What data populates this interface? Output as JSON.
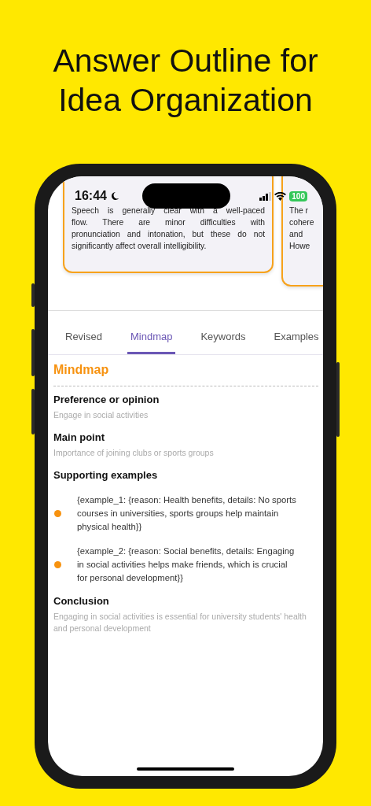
{
  "headline": [
    "Answer Outline for",
    "Idea Organization"
  ],
  "status_bar": {
    "time": "16:44",
    "battery": "100"
  },
  "feedback_cards": [
    {
      "lines": [
        "Speech is generally clear with a well-paced",
        "flow. There are minor difficulties with",
        "pronunciation and intonation, but these do not",
        "significantly affect overall intelligibility."
      ]
    },
    {
      "lines": [
        "The r",
        "cohere",
        "and",
        "Howe"
      ]
    }
  ],
  "tabs": [
    {
      "label": "Revised",
      "selected": false
    },
    {
      "label": "Mindmap",
      "selected": true
    },
    {
      "label": "Keywords",
      "selected": false
    },
    {
      "label": "Examples",
      "selected": false
    }
  ],
  "mindmap": {
    "heading": "Mindmap",
    "sections": [
      {
        "kind": "text",
        "title": "Preference or opinion",
        "value": "Engage in social activities"
      },
      {
        "kind": "text",
        "title": "Main point",
        "value": "Importance of joining clubs or sports groups"
      },
      {
        "kind": "bullets",
        "title": "Supporting examples",
        "items": [
          "{example_1: {reason: Health benefits, details: No sports courses in universities, sports groups help maintain physical health}}",
          "{example_2: {reason: Social benefits, details: Engaging in social activities helps make friends, which is crucial for personal development}}"
        ]
      },
      {
        "kind": "text",
        "title": "Conclusion",
        "value": "Engaging in social activities is essential for university students' health and personal development"
      }
    ]
  }
}
